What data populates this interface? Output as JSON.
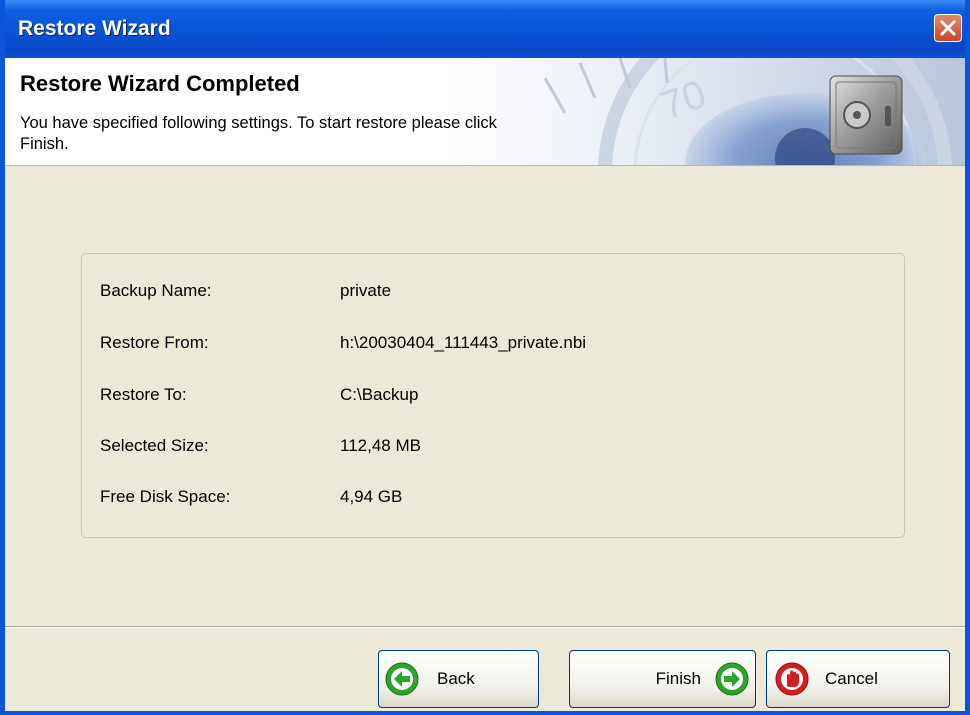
{
  "window": {
    "title": "Restore Wizard"
  },
  "header": {
    "title": "Restore Wizard Completed",
    "description": "You have specified following settings. To start restore please click Finish."
  },
  "summary": {
    "rows": [
      {
        "label": "Backup Name:",
        "value": "private"
      },
      {
        "label": "Restore From:",
        "value": "h:\\20030404_111443_private.nbi"
      },
      {
        "label": "Restore To:",
        "value": "C:\\Backup"
      },
      {
        "label": "Selected Size:",
        "value": "112,48 MB"
      },
      {
        "label": "Free Disk Space:",
        "value": "4,94 GB"
      }
    ]
  },
  "buttons": {
    "back_label": "Back",
    "finish_label": "Finish",
    "cancel_label": "Cancel"
  },
  "icons": {
    "close": "close-icon",
    "safe": "safe-icon",
    "back": "arrow-left-icon",
    "finish": "arrow-right-icon",
    "cancel": "stop-hand-icon"
  },
  "colors": {
    "titlebar": "#0A53D6",
    "window_bg": "#ECE9D8",
    "button_border": "#003C74",
    "nav_green": "#2DA52D",
    "cancel_red": "#D21E1E"
  }
}
